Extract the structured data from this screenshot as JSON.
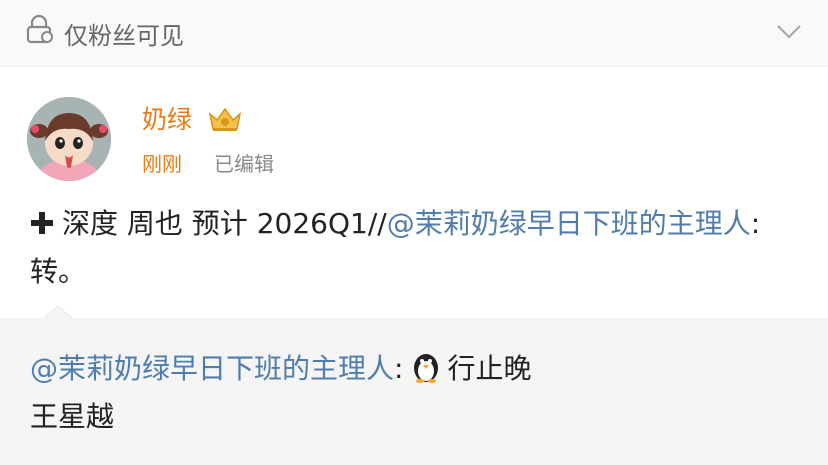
{
  "visibility": {
    "label": "仅粉丝可见",
    "icon": "lock-icon",
    "expand_icon": "chevron-down-icon"
  },
  "post": {
    "author": "奶绿",
    "badge_icon": "crown-icon",
    "time": "刚刚",
    "edited": "已编辑",
    "content": {
      "plus_icon": "plus-icon",
      "text": "深度 周也  预计 2026Q1//",
      "mention": "@茉莉奶绿早日下班的主理人",
      "suffix": ":转。"
    }
  },
  "repost": {
    "mention": "@茉莉奶绿早日下班的主理人",
    "colon": ":",
    "emoji_icon": "penguin-icon",
    "text_1": "行止晚",
    "text_2": "王星越"
  },
  "colors": {
    "link": "#507daf",
    "author": "#eb7b18",
    "repost_bg": "#f5f5f5"
  }
}
